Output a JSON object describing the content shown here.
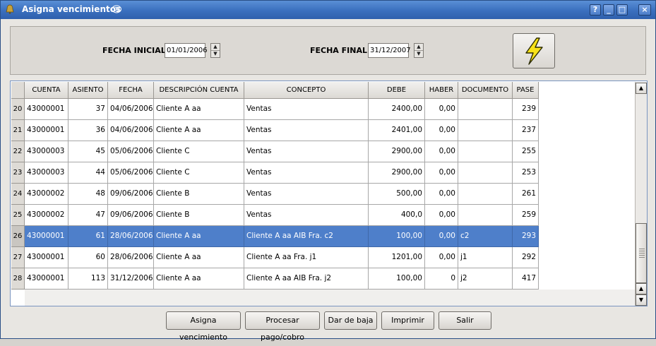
{
  "window": {
    "title": "Asigna vencimientos",
    "controls": [
      "?",
      "_",
      "□",
      "×"
    ]
  },
  "filters": {
    "fecha_inicial_label": "FECHA INICIAL:",
    "fecha_inicial_value": "01/01/2006",
    "fecha_final_label": "FECHA FINAL:",
    "fecha_final_value": "31/12/2007",
    "action_icon": "lightning-bolt-icon"
  },
  "table": {
    "columns": [
      "CUENTA",
      "ASIENTO",
      "FECHA",
      "DESCRIPCIÓN CUENTA",
      "CONCEPTO",
      "DEBE",
      "HABER",
      "DOCUMENTO",
      "PASE"
    ],
    "rows": [
      {
        "num": "20",
        "cuenta": "43000001",
        "asiento": "37",
        "fecha": "04/06/2006",
        "descripcion": "Cliente A aa",
        "concepto": "Ventas",
        "debe": "2400,00",
        "haber": "0,00",
        "documento": "",
        "pase": "239",
        "selected": false
      },
      {
        "num": "21",
        "cuenta": "43000001",
        "asiento": "36",
        "fecha": "04/06/2006",
        "descripcion": "Cliente A aa",
        "concepto": "Ventas",
        "debe": "2401,00",
        "haber": "0,00",
        "documento": "",
        "pase": "237",
        "selected": false
      },
      {
        "num": "22",
        "cuenta": "43000003",
        "asiento": "45",
        "fecha": "05/06/2006",
        "descripcion": "Cliente C",
        "concepto": "Ventas",
        "debe": "2900,00",
        "haber": "0,00",
        "documento": "",
        "pase": "255",
        "selected": false
      },
      {
        "num": "23",
        "cuenta": "43000003",
        "asiento": "44",
        "fecha": "05/06/2006",
        "descripcion": "Cliente C",
        "concepto": "Ventas",
        "debe": "2900,00",
        "haber": "0,00",
        "documento": "",
        "pase": "253",
        "selected": false
      },
      {
        "num": "24",
        "cuenta": "43000002",
        "asiento": "48",
        "fecha": "09/06/2006",
        "descripcion": "Cliente B",
        "concepto": "Ventas",
        "debe": "500,00",
        "haber": "0,00",
        "documento": "",
        "pase": "261",
        "selected": false
      },
      {
        "num": "25",
        "cuenta": "43000002",
        "asiento": "47",
        "fecha": "09/06/2006",
        "descripcion": "Cliente B",
        "concepto": "Ventas",
        "debe": "400,0",
        "haber": "0,00",
        "documento": "",
        "pase": "259",
        "selected": false
      },
      {
        "num": "26",
        "cuenta": "43000001",
        "asiento": "61",
        "fecha": "28/06/2006",
        "descripcion": "Cliente A aa",
        "concepto": "Cliente A aa AIB Fra. c2",
        "debe": "100,00",
        "haber": "0,00",
        "documento": "c2",
        "pase": "293",
        "selected": true
      },
      {
        "num": "27",
        "cuenta": "43000001",
        "asiento": "60",
        "fecha": "28/06/2006",
        "descripcion": "Cliente A aa",
        "concepto": "Cliente A aa Fra. j1",
        "debe": "1201,00",
        "haber": "0,00",
        "documento": "j1",
        "pase": "292",
        "selected": false
      },
      {
        "num": "28",
        "cuenta": "43000001",
        "asiento": "113",
        "fecha": "31/12/2006",
        "descripcion": "Cliente A aa",
        "concepto": "Cliente A aa AIB Fra. j2",
        "debe": "100,00",
        "haber": "0",
        "documento": "j2",
        "pase": "417",
        "selected": false
      }
    ]
  },
  "buttons": {
    "asigna": "Asigna vencimiento",
    "procesar": "Procesar pago/cobro",
    "baja": "Dar de baja",
    "imprimir": "Imprimir",
    "salir": "Salir"
  },
  "colors": {
    "titlebar": "#3a6fbe",
    "selection": "#4e7fca"
  }
}
